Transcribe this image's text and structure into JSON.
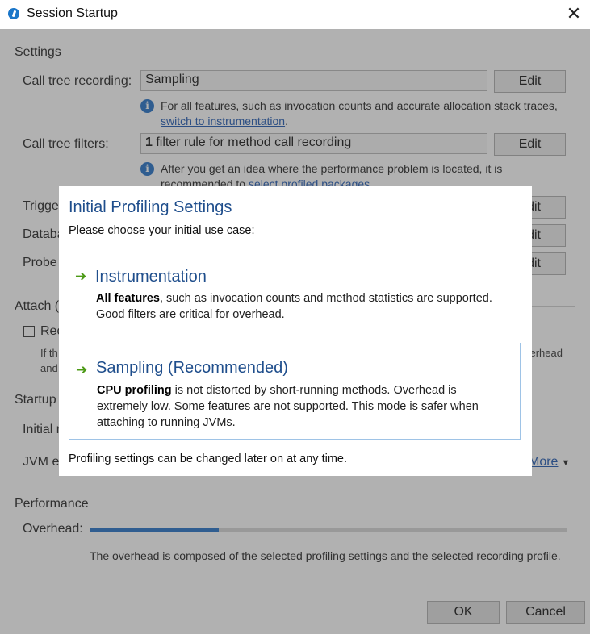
{
  "window": {
    "title": "Session Startup",
    "close_glyph": "✕"
  },
  "settings": {
    "heading": "Settings",
    "call_tree_recording": {
      "label": "Call tree recording:",
      "value": "Sampling",
      "edit": "Edit",
      "note_prefix": "For all features, such as invocation counts and accurate allocation stack traces, ",
      "note_link": "switch to instrumentation",
      "note_suffix": "."
    },
    "call_tree_filters": {
      "label": "Call tree filters:",
      "value_bold": "1",
      "value_rest": " filter rule for method call recording",
      "edit": "Edit",
      "note_prefix": "After you get an idea where the performance problem is located, it is recommended to ",
      "note_link": "select profiled packages"
    },
    "trigger_label": "Trigge",
    "database_label": "Databa",
    "probe_label": "Probe",
    "edit_stub": "dit"
  },
  "attach": {
    "heading": "Attach (",
    "checkbox_label": "Rec",
    "text_line1": "If th",
    "text_line2": "and",
    "overhead_stub": "verhead"
  },
  "startup": {
    "heading": "Startup",
    "initial_label": "Initial r",
    "jvm_label": "JVM e",
    "more_link": "More"
  },
  "performance": {
    "heading": "Performance",
    "overhead_label": "Overhead:",
    "overhead_fraction": 0.27,
    "note": "The overhead is composed of the selected profiling settings and the selected recording profile."
  },
  "buttons": {
    "ok": "OK",
    "cancel": "Cancel"
  },
  "modal": {
    "title": "Initial Profiling Settings",
    "subtitle": "Please choose your initial use case:",
    "options": [
      {
        "title": "Instrumentation",
        "desc_bold": "All features",
        "desc_rest": ", such as invocation counts and method statistics are supported. Good filters are critical for overhead."
      },
      {
        "title": "Sampling (Recommended)",
        "desc_bold": "CPU profiling",
        "desc_rest": " is not distorted by short-running methods. Overhead is extremely low. Some features are not supported. This mode is safer when attaching to running JVMs."
      }
    ],
    "footer": "Profiling settings can be changed later on at any time."
  },
  "colors": {
    "accent": "#1f4e8c",
    "link": "#1a55b0",
    "arrow": "#4c9a16",
    "info": "#1f6fc6"
  }
}
